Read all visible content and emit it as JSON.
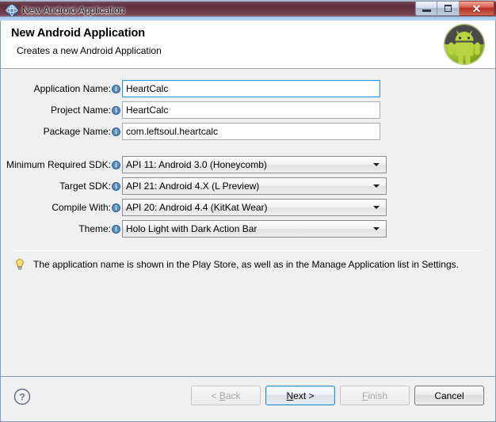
{
  "window": {
    "title": "New Android Application",
    "icon": "eclipse-globe-icon",
    "controls": {
      "minimize": "minimize-button",
      "maximize": "maximize-button",
      "close": "close-button"
    }
  },
  "header": {
    "title": "New Android Application",
    "subtitle": "Creates a new Android Application",
    "logo": "android-robot-logo"
  },
  "form": {
    "text_fields": [
      {
        "label": "Application Name:",
        "value": "HeartCalc",
        "focused": true
      },
      {
        "label": "Project Name:",
        "value": "HeartCalc",
        "focused": false
      },
      {
        "label": "Package Name:",
        "value": "com.leftsoul.heartcalc",
        "focused": false
      }
    ],
    "combos": [
      {
        "label": "Minimum Required SDK:",
        "value": "API 11: Android 3.0 (Honeycomb)"
      },
      {
        "label": "Target SDK:",
        "value": "API 21: Android 4.X (L Preview)"
      },
      {
        "label": "Compile With:",
        "value": "API 20: Android 4.4 (KitKat Wear)"
      },
      {
        "label": "Theme:",
        "value": "Holo Light with Dark Action Bar"
      }
    ]
  },
  "hint": {
    "icon": "lightbulb-icon",
    "text": "The application name is shown in the Play Store, as well as in the Manage Application list in Settings."
  },
  "buttons": {
    "help": "help-icon",
    "back": {
      "label": "< Back",
      "mnemonic": "B",
      "disabled": true
    },
    "next": {
      "label": "Next >",
      "mnemonic": "N",
      "disabled": false,
      "default": true
    },
    "finish": {
      "label": "Finish",
      "mnemonic": "F",
      "disabled": true
    },
    "cancel": {
      "label": "Cancel",
      "mnemonic": "",
      "disabled": false
    }
  },
  "colors": {
    "accent_blue": "#3c99d4",
    "android_green": "#a4c639",
    "titlebar_maroon": "#5e2f3e",
    "body_background": "#f0f0f0",
    "close_red": "#b62e22"
  }
}
